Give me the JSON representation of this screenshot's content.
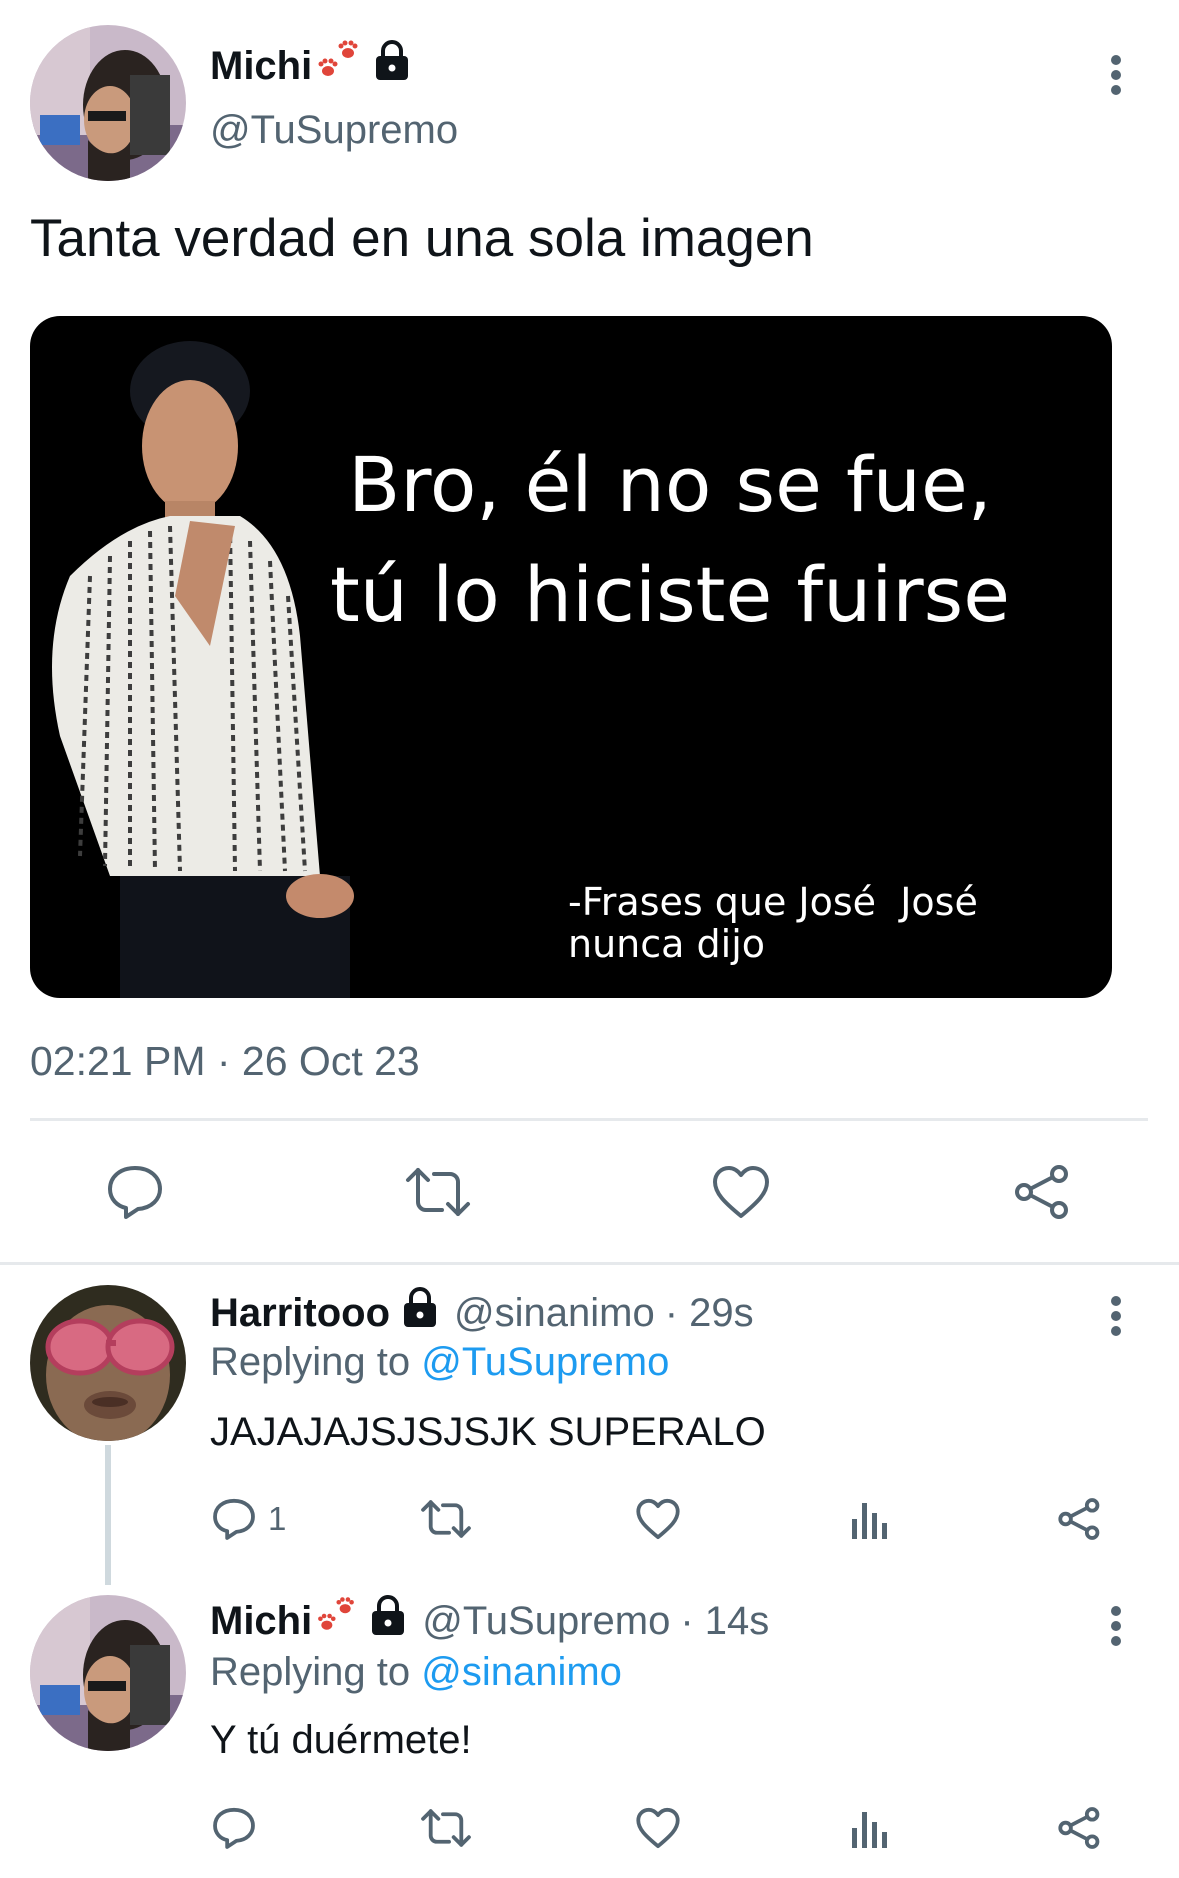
{
  "main_tweet": {
    "display_name": "Michi",
    "handle": "@TuSupremo",
    "text": "Tanta verdad en una sola imagen",
    "meme": {
      "line1": "Bro, él no se fue,",
      "line2": "tú lo hiciste fuirse",
      "caption_line1": "-Frases que José  José",
      "caption_line2": "nunca dijo"
    },
    "timestamp": "02:21 PM · 26 Oct 23"
  },
  "replies": [
    {
      "display_name": "Harritooo",
      "handle": "@sinanimo",
      "time": "· 29s",
      "replying_prefix": "Replying to ",
      "replying_to": "@TuSupremo",
      "text": "JAJAJAJSJSJSJK SUPERALO",
      "reply_count": "1"
    },
    {
      "display_name": "Michi",
      "handle": "@TuSupremo",
      "time": "· 14s",
      "replying_prefix": "Replying to ",
      "replying_to": "@sinanimo",
      "text": "Y tú duérmete!",
      "reply_count": ""
    }
  ],
  "icons": {
    "reply": "reply-icon",
    "retweet": "retweet-icon",
    "like": "heart-icon",
    "analytics": "analytics-icon",
    "share": "share-icon",
    "lock": "lock-icon",
    "more": "more-icon",
    "paw": "paw-prints-icon"
  },
  "colors": {
    "link": "#1d9bf0",
    "muted": "#536471",
    "text": "#0f1419",
    "paw": "#e0453a"
  }
}
